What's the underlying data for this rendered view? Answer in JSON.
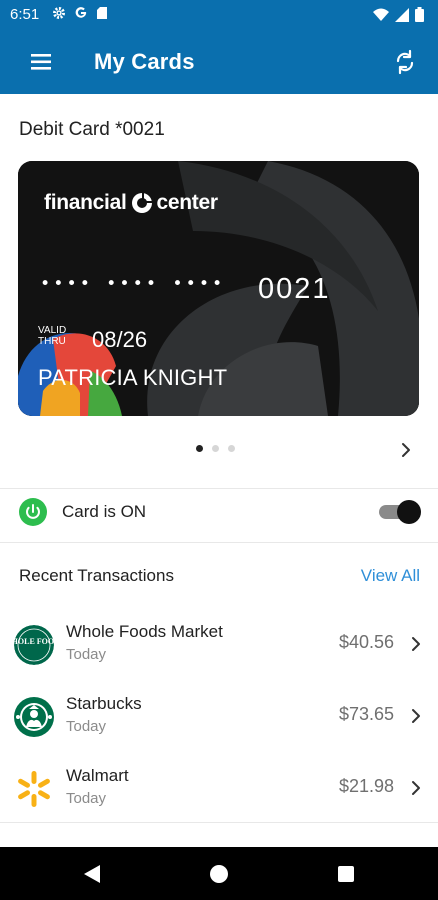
{
  "status_bar": {
    "time": "6:51",
    "icons_left": [
      "gear-icon",
      "google-icon",
      "sd-card-icon"
    ],
    "icons_right": [
      "wifi-icon",
      "cellular-icon",
      "battery-icon"
    ]
  },
  "app_bar": {
    "title": "My Cards",
    "menu_icon": "hamburger-menu-icon",
    "refresh_icon": "refresh-icon",
    "color": "#0a6fae"
  },
  "card": {
    "heading": "Debit Card *0021",
    "brand_left": "financial",
    "brand_right": "center",
    "masked_number": "•••• •••• ••••",
    "last4": "0021",
    "valid_thru_label": "VALID THRU",
    "expiry": "08/26",
    "holder": "PATRICIA KNIGHT"
  },
  "pager": {
    "total": 3,
    "active": 1,
    "next_icon": "chevron-right-icon"
  },
  "card_toggle": {
    "status_text": "Card is ON",
    "is_on": true,
    "icon": "power-icon",
    "icon_color": "#2dbd4e"
  },
  "transactions": {
    "heading": "Recent Transactions",
    "view_all": "View All",
    "link_color": "#2f8fd8",
    "items": [
      {
        "merchant": "Whole Foods Market",
        "date": "Today",
        "amount": "$40.56",
        "logo_text": "WHOLE FOODS",
        "icon": "whole-foods-logo-icon"
      },
      {
        "merchant": "Starbucks",
        "date": "Today",
        "amount": "$73.65",
        "icon": "starbucks-logo-icon"
      },
      {
        "merchant": "Walmart",
        "date": "Today",
        "amount": "$21.98",
        "icon": "walmart-spark-icon"
      }
    ]
  },
  "nav_bar": {
    "buttons": [
      "back-icon",
      "home-icon",
      "recents-icon"
    ]
  }
}
